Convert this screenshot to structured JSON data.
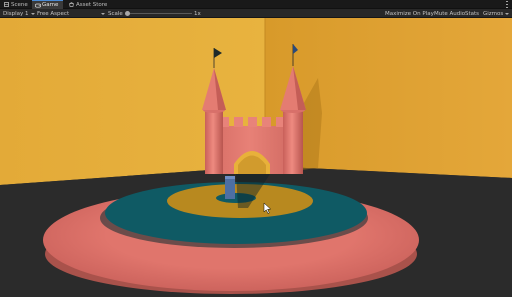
{
  "tabs": [
    {
      "label": "Scene",
      "icon": "scene-icon",
      "active": false
    },
    {
      "label": "Game",
      "icon": "game-icon",
      "active": true
    },
    {
      "label": "Asset Store",
      "icon": "asset-store-icon",
      "active": false
    }
  ],
  "toolbar": {
    "display": "Display 1",
    "aspect": "Free Aspect",
    "scale_label": "Scale",
    "scale_value": "1x",
    "maximize": "Maximize On Play",
    "mute": "Mute Audio",
    "stats": "Stats",
    "gizmos": "Gizmos"
  },
  "colors": {
    "wall": "#e8b13a",
    "floor": "#2b2b2b",
    "outer_disc": "#e47d73",
    "teal_ring": "#0f5b66",
    "gold_ring": "#b6891f",
    "castle": "#e57b73",
    "accent": "#4a8bd6"
  }
}
